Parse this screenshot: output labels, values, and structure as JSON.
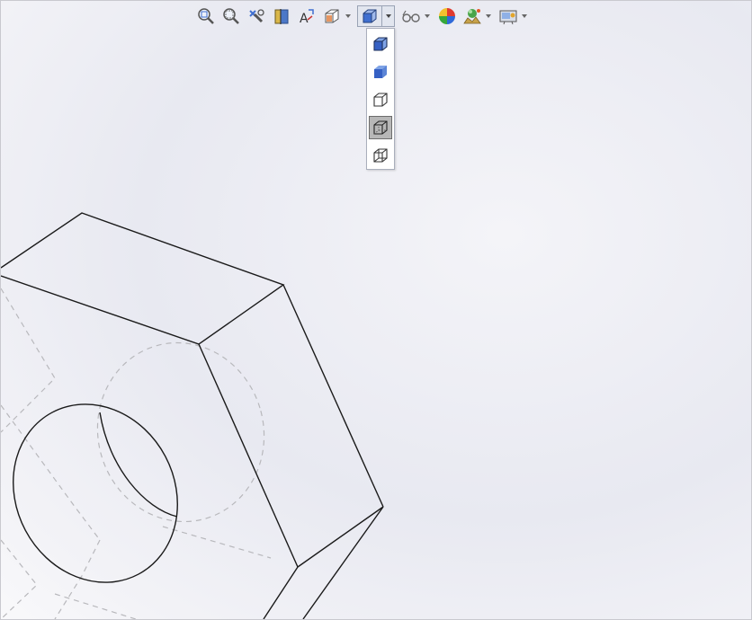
{
  "toolbar": {
    "items": [
      {
        "name": "zoom-to-fit-icon"
      },
      {
        "name": "zoom-to-area-icon"
      },
      {
        "name": "previous-view-icon"
      },
      {
        "name": "section-view-icon"
      },
      {
        "name": "dynamic-annotation-views-icon"
      },
      {
        "name": "view-orientation-icon",
        "has_dropdown": true
      },
      {
        "name": "display-style-icon",
        "has_dropdown": true,
        "active": true
      },
      {
        "name": "hide-show-items-icon",
        "has_dropdown": true
      },
      {
        "name": "edit-appearance-icon"
      },
      {
        "name": "apply-scene-icon",
        "has_dropdown": true
      },
      {
        "name": "view-settings-icon",
        "has_dropdown": true
      }
    ]
  },
  "display_style_menu": {
    "items": [
      {
        "name": "shaded-with-edges-icon",
        "selected": false
      },
      {
        "name": "shaded-icon",
        "selected": false
      },
      {
        "name": "hidden-lines-removed-icon",
        "selected": false
      },
      {
        "name": "hidden-lines-visible-icon",
        "selected": true
      },
      {
        "name": "wireframe-icon",
        "selected": false
      }
    ]
  },
  "colors": {
    "accent_blue": "#3f6fd0",
    "selected_bg": "#b7b7b7",
    "model_edge": "#1a1a1a",
    "hidden_edge": "#b8b8bc"
  }
}
